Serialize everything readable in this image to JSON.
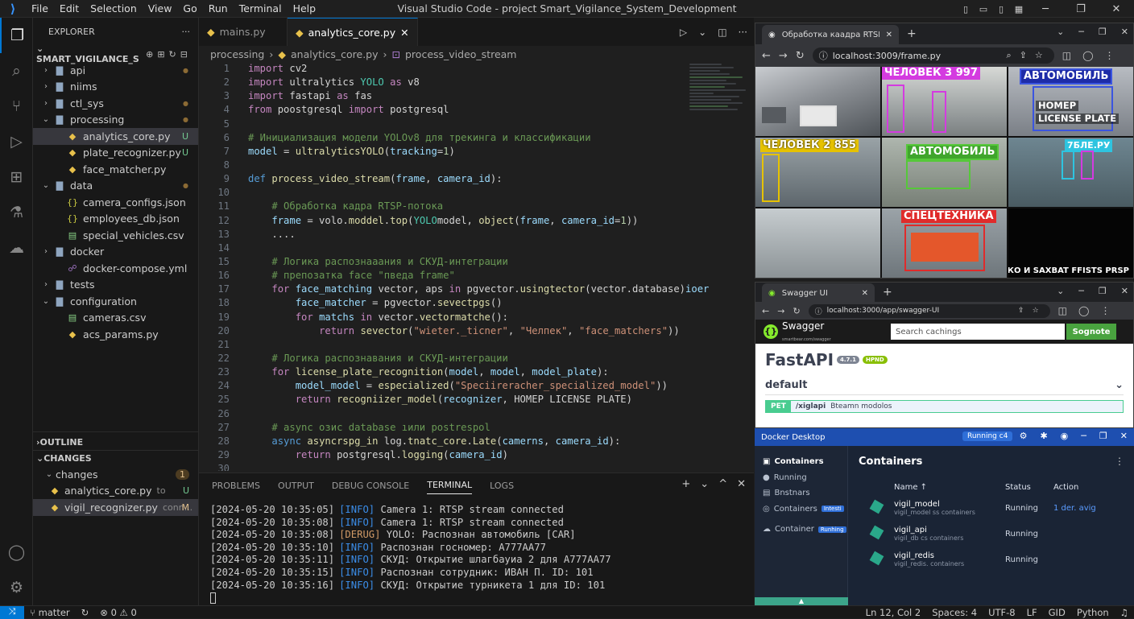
{
  "titlebar": {
    "menu": [
      "File",
      "Edit",
      "Selection",
      "View",
      "Go",
      "Run",
      "Terminal",
      "Help"
    ],
    "title": "Visual Studio Code - project Smart_Vigilance_System_Development"
  },
  "explorer": {
    "header": "EXPLORER",
    "root": "SMART_VIGILANCE_S",
    "tree": [
      {
        "label": "api",
        "type": "folder",
        "depth": 0,
        "open": false,
        "dot": true
      },
      {
        "label": "niims",
        "type": "folder",
        "depth": 0,
        "open": false
      },
      {
        "label": "ctl_sys",
        "type": "folder",
        "depth": 0,
        "open": false,
        "dot": true
      },
      {
        "label": "processing",
        "type": "folder",
        "depth": 0,
        "open": true,
        "dot": true
      },
      {
        "label": "analytics_core.py",
        "type": "py",
        "depth": 1,
        "badge": "U",
        "selected": true
      },
      {
        "label": "plate_recognizer.py",
        "type": "py",
        "depth": 1,
        "badge": "U"
      },
      {
        "label": "face_matcher.py",
        "type": "py",
        "depth": 1
      },
      {
        "label": "data",
        "type": "folder",
        "depth": 0,
        "open": true,
        "dot": true
      },
      {
        "label": "camera_configs.json",
        "type": "json",
        "depth": 1
      },
      {
        "label": "employees_db.json",
        "type": "json",
        "depth": 1
      },
      {
        "label": "special_vehicles.csv",
        "type": "csv",
        "depth": 1
      },
      {
        "label": "docker",
        "type": "folder",
        "depth": 0,
        "open": false
      },
      {
        "label": "docker-compose.yml",
        "type": "yml",
        "depth": 1
      },
      {
        "label": "tests",
        "type": "folder",
        "depth": 0,
        "open": false
      },
      {
        "label": "configuration",
        "type": "folder",
        "depth": 0,
        "open": true
      },
      {
        "label": "cameras.csv",
        "type": "csv",
        "depth": 1
      },
      {
        "label": "acs_params.py",
        "type": "py",
        "depth": 1
      }
    ],
    "outline": "OUTLINE",
    "changes": "CHANGES",
    "changes_group": "changes",
    "changes_count": "1",
    "changed_files": [
      {
        "label": "analytics_core.py",
        "hint": "to",
        "badge": "U"
      },
      {
        "label": "vigil_recognizer.py",
        "hint": "conn...",
        "badge": "M"
      }
    ]
  },
  "editor": {
    "tabs": [
      {
        "label": "mains.py"
      },
      {
        "label": "analytics_core.py",
        "active": true
      }
    ],
    "breadcrumbs": [
      "processing",
      "analytics_core.py",
      "process_video_stream"
    ]
  },
  "panel": {
    "tabs": [
      "PROBLEMS",
      "OUTPUT",
      "DEBUG CONSOLE",
      "TERMINAL",
      "LOGS"
    ],
    "active": "TERMINAL",
    "terminal": [
      {
        "ts": "[2024-05-20 10:35:05]",
        "lvl": "[INFO]",
        "msg": " Camera 1: RTSP stream connected"
      },
      {
        "ts": "[2024-05-20 10:35:08]",
        "lvl": "[INFO]",
        "msg": " Camera 1: RTSP stream connected"
      },
      {
        "ts": "[2024-05-20 10:35:08]",
        "lvl": "[DERUG]",
        "msg": " YOLO: Распознан автомобиль [CAR]"
      },
      {
        "ts": "[2024-05-20 10:35:10]",
        "lvl": "[INFO]",
        "msg": " Распознан госномер: A777AA77"
      },
      {
        "ts": "[2024-05-20 10:35:11]",
        "lvl": "[INFO]",
        "msg": " СКУД: Открытие шлагбауиа 2 для A777AA77"
      },
      {
        "ts": "[2024-05-20 10:35:15]",
        "lvl": "[INFO]",
        "msg": " Распознан сотрудник: ИВАН П. ID: 101"
      },
      {
        "ts": "[2024-05-20 10:35:16]",
        "lvl": "[INFO]",
        "msg": " СКУД: Открытие турникета 1 для ID: 101"
      }
    ]
  },
  "status": {
    "branch": "matter",
    "problems": "⊗ 0 ⚠ 0",
    "position": "Ln 12, Col 2",
    "spaces": "Spaces: 4",
    "encoding": "UTF-8",
    "eol": "LF",
    "git": "GID",
    "language": "Python"
  },
  "browser1": {
    "tab": "Обработка каадра RTSP-потока",
    "url": "localhost:3009/frame.py",
    "cams": [
      {
        "label": "",
        "color": "#9b9b9b"
      },
      {
        "label": "ЧЕЛОВЕК 3 997",
        "color": "#d43be0"
      },
      {
        "label": "АВТОМОБИЛЬ",
        "color": "#3b55e0"
      },
      {
        "label": "ЧЕЛОВЕК 2 855",
        "color": "#e6c200"
      },
      {
        "label": "АВТОМОБИЛЬ",
        "color": "#56c83a"
      },
      {
        "label": "7БЛЕ.РУ",
        "color": "#2ec4e0"
      },
      {
        "label": "",
        "color": "#9b9b9b"
      },
      {
        "label": "СПЕЦТЕХНИКА",
        "color": "#e02b2b"
      },
      {
        "label": "ЖАЛИКО И SAXBAT FFISTS PRSP",
        "color": "#000000"
      }
    ],
    "plate_text_1": "НОМЕР",
    "plate_text_2": "LICENSE PLATE"
  },
  "browser2": {
    "tab": "Swagger UI",
    "url": "localhost:3000/app/swagger-UI",
    "search_placeholder": "Search cachings",
    "search_button": "Sognote",
    "logo": "Swagger",
    "logo_sub": "smartbear.com/swagger",
    "title": "FastAPI",
    "version": "4.7.1",
    "oas": "HPND",
    "section": "default",
    "op_method": "PET",
    "op_path": "/xiglapi",
    "op_desc": "Bteamn modolos"
  },
  "docker": {
    "title": "Docker Desktop",
    "running_badge": "Running  c4",
    "nav": [
      {
        "label": "Containers",
        "active": true
      },
      {
        "label": "Running"
      },
      {
        "label": "Bnstnars"
      },
      {
        "label": "Containers",
        "tag": "Intesti"
      },
      {
        "label": "Container",
        "tag": "Runhing"
      }
    ],
    "heading": "Containers",
    "cols": [
      "Name ↑",
      "Status",
      "Action"
    ],
    "rows": [
      {
        "name": "vigil_model",
        "sub": "vigil_model ss containers",
        "status": "Running",
        "action": "1 der. avig"
      },
      {
        "name": "vigil_api",
        "sub": "vigil_db cs containers",
        "status": "Running",
        "action": ""
      },
      {
        "name": "vigil_redis",
        "sub": "vigil_redis. containers",
        "status": "Running",
        "action": ""
      }
    ]
  }
}
